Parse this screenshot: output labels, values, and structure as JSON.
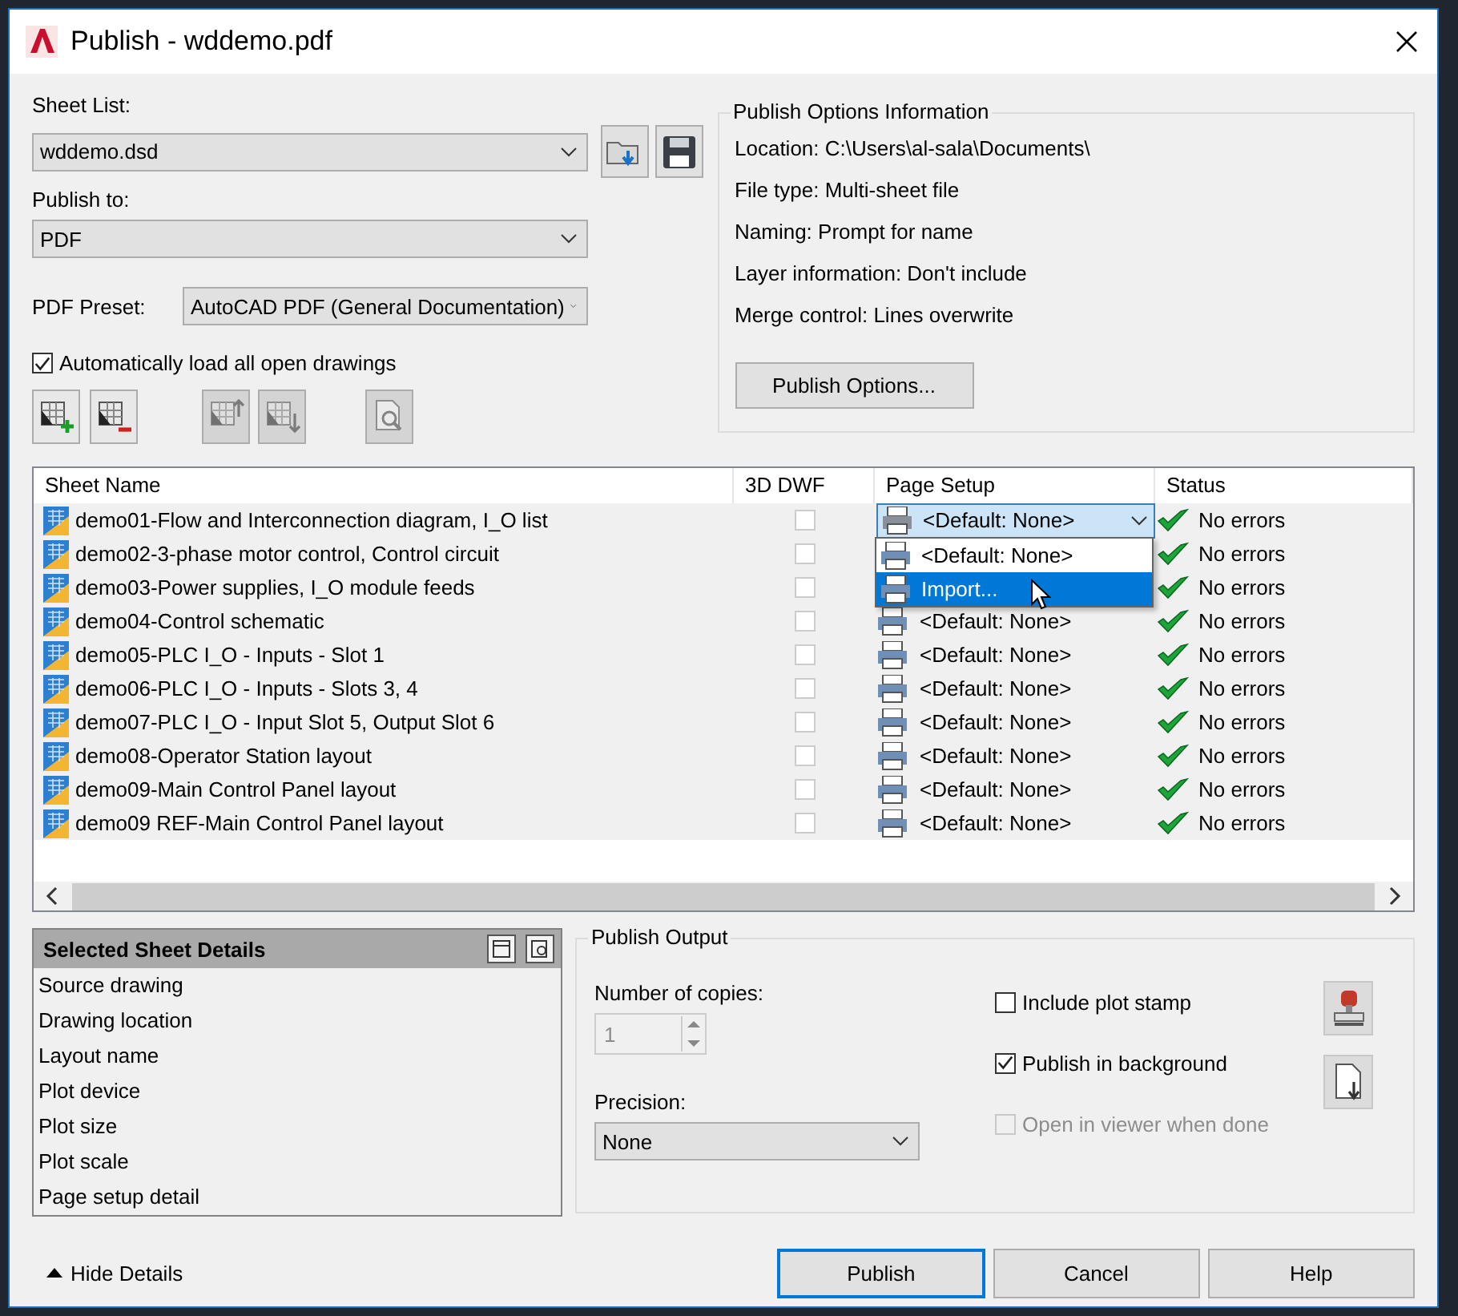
{
  "window": {
    "title": "Publish - wddemo.pdf"
  },
  "sheet_list": {
    "label": "Sheet List:",
    "value": "wddemo.dsd"
  },
  "publish_to": {
    "label": "Publish to:",
    "value": "PDF"
  },
  "pdf_preset": {
    "label": "PDF Preset:",
    "value": "AutoCAD PDF (General Documentation)"
  },
  "auto_load": {
    "label": "Automatically load all open drawings",
    "checked": true
  },
  "sheet_toolbar": [
    {
      "kind": "add",
      "disabled": false
    },
    {
      "kind": "remove",
      "disabled": false
    },
    {
      "kind": "up",
      "disabled": true
    },
    {
      "kind": "down",
      "disabled": true
    },
    {
      "kind": "preview",
      "disabled": true
    }
  ],
  "publish_options_info": {
    "title": "Publish Options Information",
    "items": [
      {
        "label": "Location:",
        "value": "C:\\Users\\al-sala\\Documents\\"
      },
      {
        "label": "File type:",
        "value": "Multi-sheet file"
      },
      {
        "label": "Naming:",
        "value": "Prompt for name"
      },
      {
        "label": "Layer information:",
        "value": "Don't include"
      },
      {
        "label": "Merge control:",
        "value": "Lines overwrite"
      }
    ],
    "button": "Publish Options..."
  },
  "table": {
    "columns": [
      "Sheet Name",
      "3D DWF",
      "Page Setup",
      "Status"
    ],
    "rows": [
      {
        "name": "demo01-Flow and Interconnection diagram, I_O list",
        "dwf3d": false,
        "page_setup": "<Default: None>",
        "expanded": true,
        "options": [
          {
            "label": "<Default: None>",
            "selected": false
          },
          {
            "label": "Import...",
            "selected": true
          }
        ],
        "status": "No errors"
      },
      {
        "name": "demo02-3-phase motor control, Control circuit",
        "dwf3d": false,
        "expanded": false,
        "status": "No errors"
      },
      {
        "name": "demo03-Power supplies, I_O module feeds",
        "dwf3d": false,
        "expanded": false,
        "status": "No errors"
      },
      {
        "name": "demo04-Control schematic",
        "dwf3d": false,
        "page_setup": "<Default: None>",
        "expanded": false,
        "status": "No errors"
      },
      {
        "name": "demo05-PLC I_O - Inputs - Slot 1",
        "dwf3d": false,
        "page_setup": "<Default: None>",
        "expanded": false,
        "status": "No errors"
      },
      {
        "name": "demo06-PLC I_O - Inputs - Slots 3, 4",
        "dwf3d": false,
        "page_setup": "<Default: None>",
        "expanded": false,
        "status": "No errors"
      },
      {
        "name": "demo07-PLC I_O - Input Slot 5, Output Slot 6",
        "dwf3d": false,
        "page_setup": "<Default: None>",
        "expanded": false,
        "status": "No errors"
      },
      {
        "name": "demo08-Operator Station layout",
        "dwf3d": false,
        "page_setup": "<Default: None>",
        "expanded": false,
        "status": "No errors"
      },
      {
        "name": "demo09-Main Control Panel layout",
        "dwf3d": false,
        "page_setup": "<Default: None>",
        "expanded": false,
        "status": "No errors"
      },
      {
        "name": "demo09 REF-Main Control Panel layout",
        "dwf3d": false,
        "page_setup": "<Default: None>",
        "expanded": false,
        "status": "No errors"
      }
    ]
  },
  "details": {
    "title": "Selected Sheet Details",
    "items": [
      "Source drawing",
      "Drawing location",
      "Layout name",
      "Plot device",
      "Plot size",
      "Plot scale",
      "Page setup detail"
    ]
  },
  "publish_output": {
    "title": "Publish Output",
    "copies_label": "Number of copies:",
    "copies": "1",
    "copies_disabled": true,
    "precision_label": "Precision:",
    "precision": "None",
    "options": [
      {
        "label": "Include plot stamp",
        "checked": false,
        "disabled": false
      },
      {
        "label": "Publish in background",
        "checked": true,
        "disabled": false
      },
      {
        "label": "Open in viewer when done",
        "checked": false,
        "disabled": true
      }
    ]
  },
  "hide_details": "Hide Details",
  "buttons": [
    {
      "label": "Publish",
      "default": true
    },
    {
      "label": "Cancel",
      "default": false
    },
    {
      "label": "Help",
      "default": false
    }
  ]
}
